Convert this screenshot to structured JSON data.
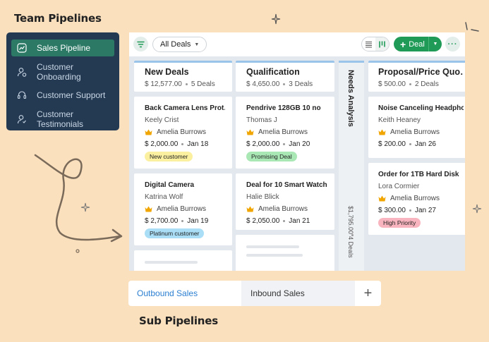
{
  "titles": {
    "team": "Team Pipelines",
    "sub": "Sub Pipelines"
  },
  "sidebar": {
    "items": [
      {
        "label": "Sales Pipeline",
        "icon": "pipeline-chart-icon",
        "active": true
      },
      {
        "label": "Customer Onboarding",
        "icon": "user-onboarding-icon",
        "active": false
      },
      {
        "label": "Customer Support",
        "icon": "headset-icon",
        "active": false
      },
      {
        "label": "Customer Testimonials",
        "icon": "user-testimonial-icon",
        "active": false
      }
    ]
  },
  "toolbar": {
    "filter_icon": "filter-icon",
    "deals_select": "All Deals",
    "add_button": "Deal",
    "more_icon": "more-dots-icon"
  },
  "lanes": [
    {
      "title": "New Deals",
      "amount": "$ 12,577.00",
      "count": "5 Deals",
      "cards": [
        {
          "title": "Back Camera Lens Prot…",
          "contact": "Keely Crist",
          "owner": "Amelia Burrows",
          "amount": "$ 2,000.00",
          "date": "Jan 18",
          "tag": "New customer",
          "tag_color": "#fbf0a0"
        },
        {
          "title": "Digital Camera",
          "contact": "Katrina Wolf",
          "owner": "Amelia Burrows",
          "amount": "$ 2,700.00",
          "date": "Jan 19",
          "tag": "Platinum customer",
          "tag_color": "#a9def6"
        }
      ]
    },
    {
      "title": "Qualification",
      "amount": "$ 4,650.00",
      "count": "3 Deals",
      "cards": [
        {
          "title": "Pendrive 128GB 10 no",
          "contact": "Thomas J",
          "owner": "Amelia Burrows",
          "amount": "$ 2,000.00",
          "date": "Jan 20",
          "tag": "Promising Deal",
          "tag_color": "#a9e7b5"
        },
        {
          "title": "Deal for 10 Smart Watch…",
          "contact": "Halie Blick",
          "owner": "Amelia Burrows",
          "amount": "$ 2,050.00",
          "date": "Jan 21",
          "tag": "",
          "tag_color": ""
        }
      ]
    },
    {
      "title": "Needs Analysis",
      "amount": "$1,795.00",
      "count": "4 Deals",
      "collapsed": true
    },
    {
      "title": "Proposal/Price Quo…",
      "amount": "$ 500.00",
      "count": "2 Deals",
      "cards": [
        {
          "title": "Noise Canceling Headpho…",
          "contact": "Keith Heaney",
          "owner": "Amelia Burrows",
          "amount": "$ 200.00",
          "date": "Jan 26",
          "tag": "",
          "tag_color": ""
        },
        {
          "title": "Order for 1TB Hard Disk",
          "contact": "Lora Cormier",
          "owner": "Amelia Burrows",
          "amount": "$ 300.00",
          "date": "Jan 27",
          "tag": "High Priority",
          "tag_color": "#f9b5bf"
        }
      ]
    }
  ],
  "subtabs": [
    {
      "label": "Outbound Sales",
      "active": true
    },
    {
      "label": "Inbound Sales",
      "active": false
    }
  ],
  "subtab_add": "+",
  "colors": {
    "accent": "#1f9b57",
    "sidebar_bg": "#243a52",
    "active_item": "#2c7a66",
    "page_bg": "#fae0bd",
    "lane_top": "#9bc4ea"
  }
}
